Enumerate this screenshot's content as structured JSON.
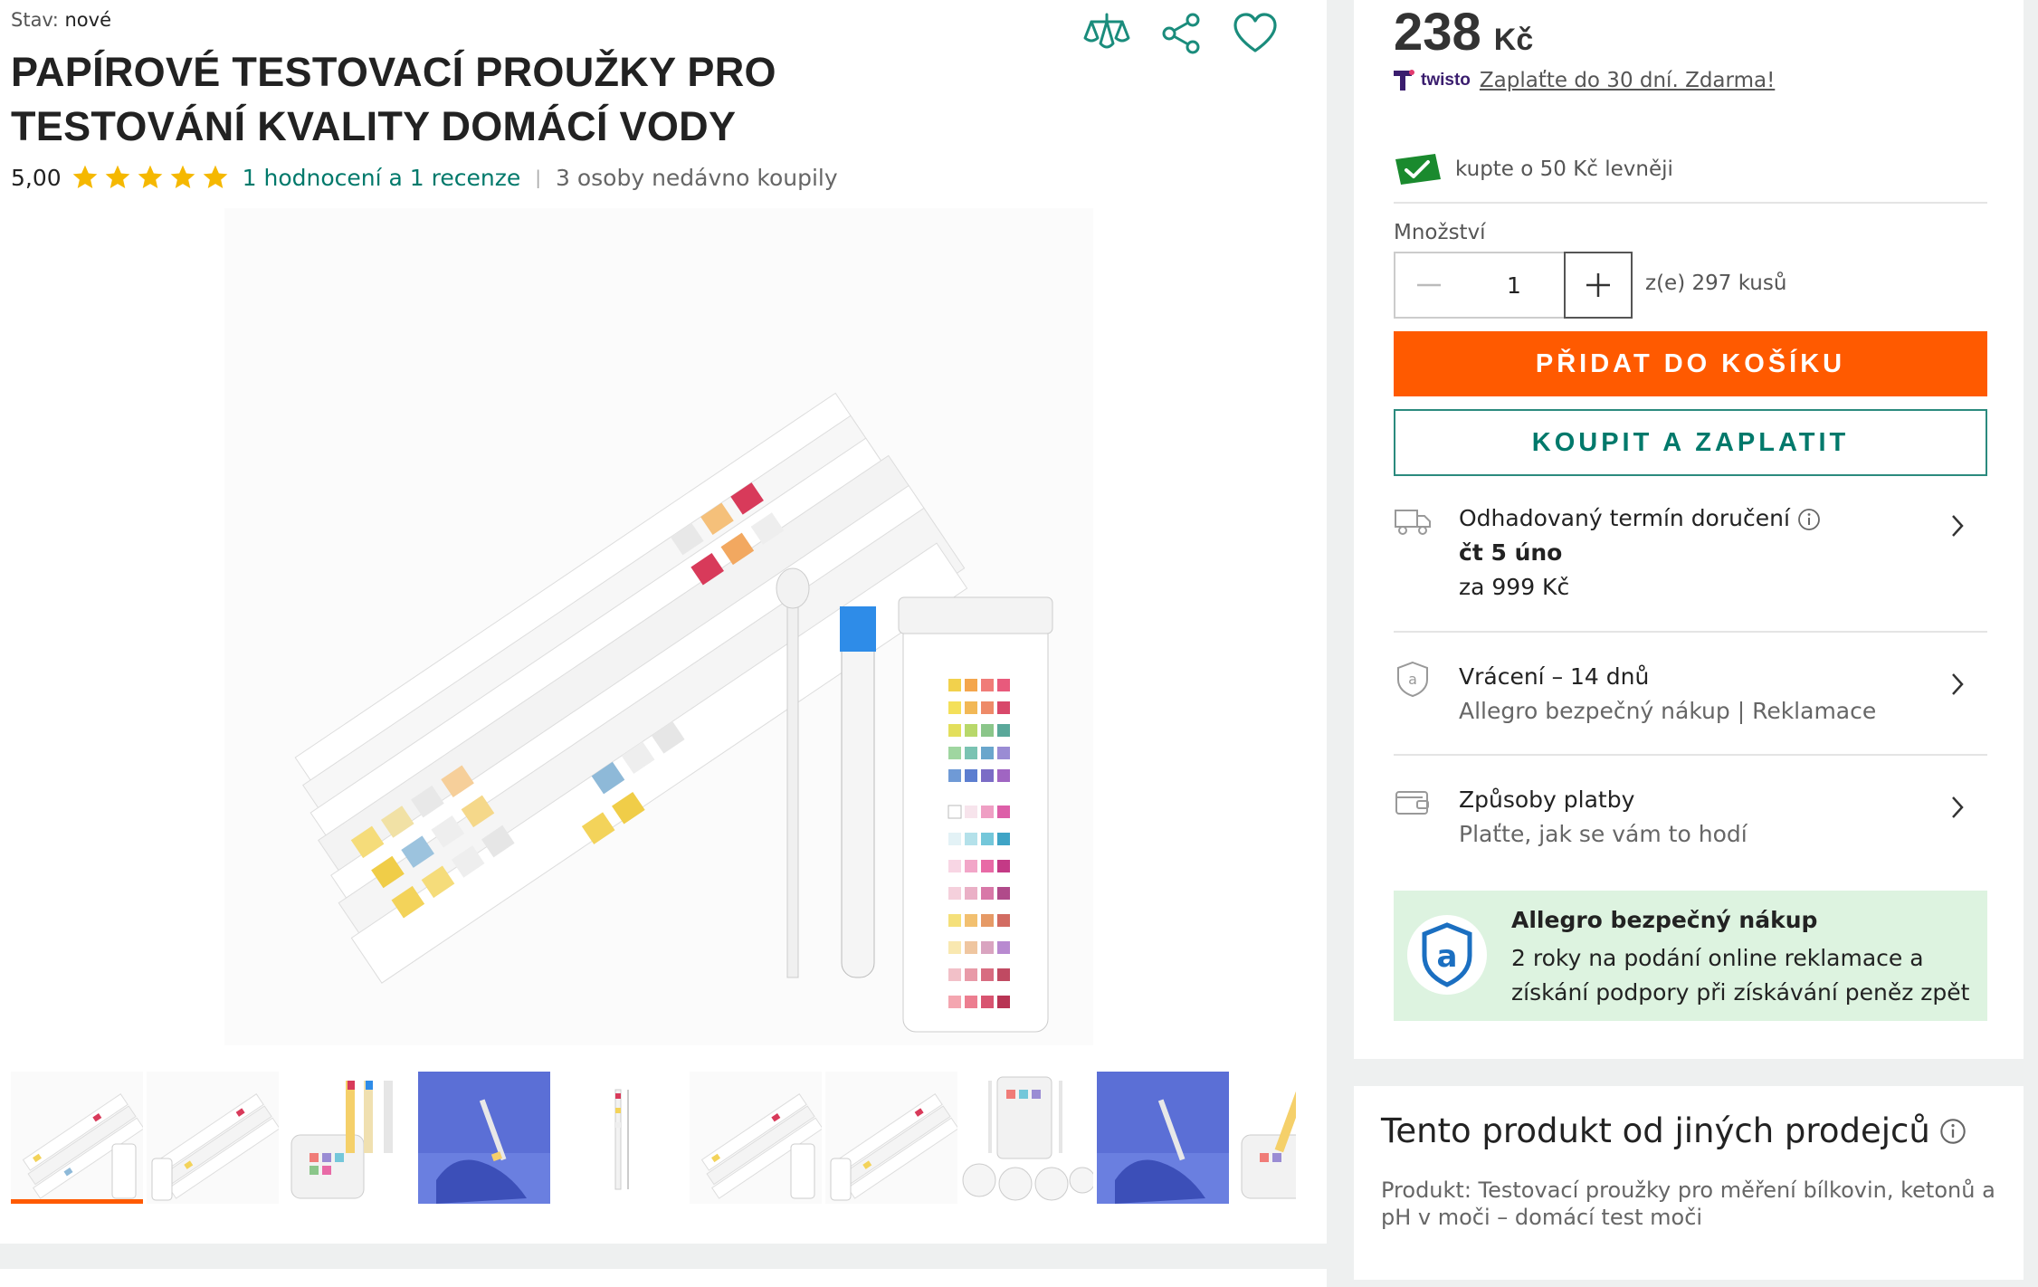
{
  "header": {
    "state_label": "Stav:",
    "state_value": "nové",
    "title": "PAPÍROVÉ TESTOVACÍ PROUŽKY PRO TESTOVÁNÍ KVALITY DOMÁCÍ VODY"
  },
  "top_icons": [
    "compare-icon",
    "share-icon",
    "heart-icon"
  ],
  "rating": {
    "score": "5,00",
    "stars": 5,
    "reviews_link": "1 hodnocení a 1 recenze",
    "separator": "|",
    "recent_buyers": "3 osoby nedávno koupily"
  },
  "gallery": {
    "thumbnails": [
      "strips",
      "strips",
      "bottle",
      "hand-blue",
      "ruler",
      "strips",
      "strips",
      "bottle-set",
      "hand-blue",
      "bottle"
    ],
    "active_index": 0
  },
  "price": {
    "amount": "238",
    "currency": "Kč"
  },
  "twisto": {
    "brand": "twisto",
    "text": "Zaplaťte do 30 dní. Zdarma!"
  },
  "cheaper": {
    "text": "kupte o 50 Kč levněji"
  },
  "quantity": {
    "label": "Množství",
    "value": "1",
    "available": "z(e) 297 kusů"
  },
  "buttons": {
    "add_to_cart": "PŘIDAT DO KOŠÍKU",
    "buy_now": "KOUPIT A ZAPLATIT"
  },
  "delivery": {
    "title": "Odhadovaný termín doručení",
    "date": "čt 5 úno",
    "price": "za 999 Kč"
  },
  "returns": {
    "title": "Vrácení – 14 dnů",
    "subtitle": "Allegro bezpečný nákup | Reklamace"
  },
  "payment": {
    "title": "Způsoby platby",
    "subtitle": "Plaťte, jak se vám to hodí"
  },
  "safe_purchase": {
    "title": "Allegro bezpečný nákup",
    "text": "2 roky na podání online reklamace a získání podpory při získávání peněz zpět"
  },
  "other_sellers": {
    "title": "Tento produkt od jiných prodejců",
    "product": "Produkt: Testovací proužky pro měření bílkovin, ketonů a pH v moči – domácí test moči"
  },
  "colors": {
    "accent_orange": "#ff5a00",
    "accent_teal": "#00796b",
    "star_yellow": "#f5b800",
    "safe_green_bg": "#ddf3e0"
  }
}
